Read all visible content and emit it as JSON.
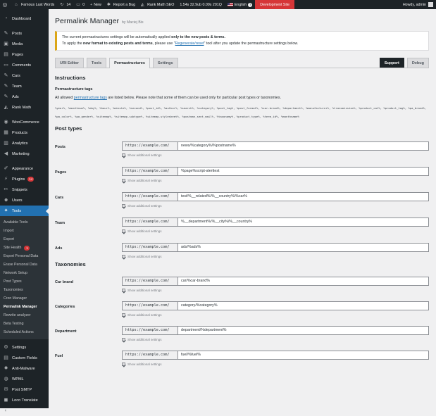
{
  "adminbar": {
    "site_name": "Famous Last Words",
    "updates": "14",
    "comments": "0",
    "new": "New",
    "report_bug": "Report a Bug",
    "seo": "Rank Math SEO",
    "stats": "1.54s  32.9ub  0.09s  201Q",
    "language": "English",
    "dev_site": "Development Site",
    "howdy": "Howdy, admin"
  },
  "sidebar": {
    "top": [
      {
        "label": "Dashboard",
        "icon": "dashboard-icon",
        "glyph": "◔"
      }
    ],
    "group1": [
      {
        "label": "Posts",
        "icon": "pin-icon",
        "glyph": "✎"
      },
      {
        "label": "Media",
        "icon": "media-icon",
        "glyph": "▣"
      },
      {
        "label": "Pages",
        "icon": "pages-icon",
        "glyph": "▤"
      },
      {
        "label": "Comments",
        "icon": "comments-icon",
        "glyph": "▭"
      },
      {
        "label": "Cars",
        "icon": "pin-icon",
        "glyph": "✎"
      },
      {
        "label": "Team",
        "icon": "pin-icon",
        "glyph": "✎"
      },
      {
        "label": "Ads",
        "icon": "pin-icon",
        "glyph": "✎"
      },
      {
        "label": "Rank Math",
        "icon": "rank-math-icon",
        "glyph": "◭"
      }
    ],
    "group2": [
      {
        "label": "WooCommerce",
        "icon": "woocommerce-icon",
        "glyph": "◉"
      },
      {
        "label": "Products",
        "icon": "products-icon",
        "glyph": "▦"
      },
      {
        "label": "Analytics",
        "icon": "analytics-icon",
        "glyph": "▥"
      },
      {
        "label": "Marketing",
        "icon": "marketing-icon",
        "glyph": "◀"
      }
    ],
    "group3": [
      {
        "label": "Appearance",
        "icon": "appearance-icon",
        "glyph": "✐"
      },
      {
        "label": "Plugins",
        "icon": "plugins-icon",
        "glyph": "⚡",
        "badge": "14"
      },
      {
        "label": "Snippets",
        "icon": "snippets-icon",
        "glyph": "✂"
      },
      {
        "label": "Users",
        "icon": "users-icon",
        "glyph": "☻"
      },
      {
        "label": "Tools",
        "icon": "tools-icon",
        "glyph": "✦",
        "current": true
      }
    ],
    "tools_submenu": [
      {
        "label": "Available Tools"
      },
      {
        "label": "Import"
      },
      {
        "label": "Export"
      },
      {
        "label": "Site Health",
        "badge": "1"
      },
      {
        "label": "Export Personal Data"
      },
      {
        "label": "Erase Personal Data"
      },
      {
        "label": "Network Setup"
      },
      {
        "label": "Post Types"
      },
      {
        "label": "Taxonomies"
      },
      {
        "label": "Cron Manager"
      },
      {
        "label": "Permalink Manager",
        "current": true
      },
      {
        "label": "Rewrite analyzer"
      },
      {
        "label": "Beta Testing"
      },
      {
        "label": "Scheduled Actions"
      }
    ],
    "group4": [
      {
        "label": "Settings",
        "icon": "settings-icon",
        "glyph": "⚙"
      },
      {
        "label": "Custom Fields",
        "icon": "custom-fields-icon",
        "glyph": "▤"
      },
      {
        "label": "Anti-Malware",
        "icon": "anti-malware-icon",
        "glyph": "✹"
      },
      {
        "label": "WPML",
        "icon": "wpml-icon",
        "glyph": "◍"
      },
      {
        "label": "Post SMTP",
        "icon": "post-smtp-icon",
        "glyph": "✉"
      },
      {
        "label": "Loco Translate",
        "icon": "loco-translate-icon",
        "glyph": "◼"
      },
      {
        "label": "Collapse menu",
        "icon": "collapse-icon",
        "glyph": "◐"
      }
    ]
  },
  "page": {
    "title": "Permalink Manager",
    "author": "by Maciej Bis",
    "notice_line1_a": "The current permastructures settings will be automatically applied ",
    "notice_line1_b": "only to the new posts & terms.",
    "notice_line2_a": "To apply the ",
    "notice_line2_b": "new format to existing posts and terms",
    "notice_line2_c": ", please use \"",
    "notice_line2_link": "Regenerate/reset",
    "notice_line2_d": "\" tool after you update the permastructure settings below."
  },
  "tabs": [
    {
      "label": "URI Editor",
      "active": false
    },
    {
      "label": "Tools",
      "active": false
    },
    {
      "label": "Permastructures",
      "active": true
    },
    {
      "label": "Settings",
      "active": false
    }
  ],
  "tabs_right": {
    "support": "Support",
    "debug": "Debug"
  },
  "instructions": {
    "title": "Instructions",
    "subtitle": "Permastructure tags",
    "text_a": "All allowed ",
    "text_link": "permastructure tags",
    "text_b": " are listed below. Please note that some of them can be used only for particular post types or taxonomies.",
    "tags": [
      "%year%",
      "%monthnum%",
      "%day%",
      "%hour%",
      "%minute%",
      "%second%",
      "%post_id%",
      "%author%",
      "%search%",
      "%category%",
      "%post_tag%",
      "%post_format%",
      "%car-brand%",
      "%department%",
      "%manufacturer%",
      "%transmission%",
      "%product_cat%",
      "%product_tag%",
      "%pa_brand%",
      "%pa_color%",
      "%pa_gender%",
      "%sitemap%",
      "%sitemap-subtype%",
      "%sitemap-stylesheet%",
      "%postman_sent_mail%",
      "%taxonomy%",
      "%product_type%",
      "%term_id%",
      "%monthname%"
    ]
  },
  "post_types": {
    "title": "Post types",
    "show_more": "Show additional settings",
    "prefix": "https://example.com/",
    "rows": [
      {
        "label": "Posts",
        "value": "news/%category%/%postname%"
      },
      {
        "label": "Pages",
        "value": "%page%script-alerttest"
      },
      {
        "label": "Cars",
        "value": "test/%__related%/%__country%/%car%"
      },
      {
        "label": "Team",
        "value": "%__department%/%__city%/%__country%"
      },
      {
        "label": "Ads",
        "value": "ads/%ads%"
      }
    ]
  },
  "taxonomies": {
    "title": "Taxonomies",
    "show_more": "Show additional settings",
    "prefix": "https://example.com/",
    "rows": [
      {
        "label": "Car brand",
        "value": "car/%car-brand%"
      },
      {
        "label": "Categories",
        "value": "category/%category%"
      },
      {
        "label": "Department",
        "value": "department/%department%"
      },
      {
        "label": "Fuel",
        "value": "fuel/%fuel%"
      }
    ]
  }
}
